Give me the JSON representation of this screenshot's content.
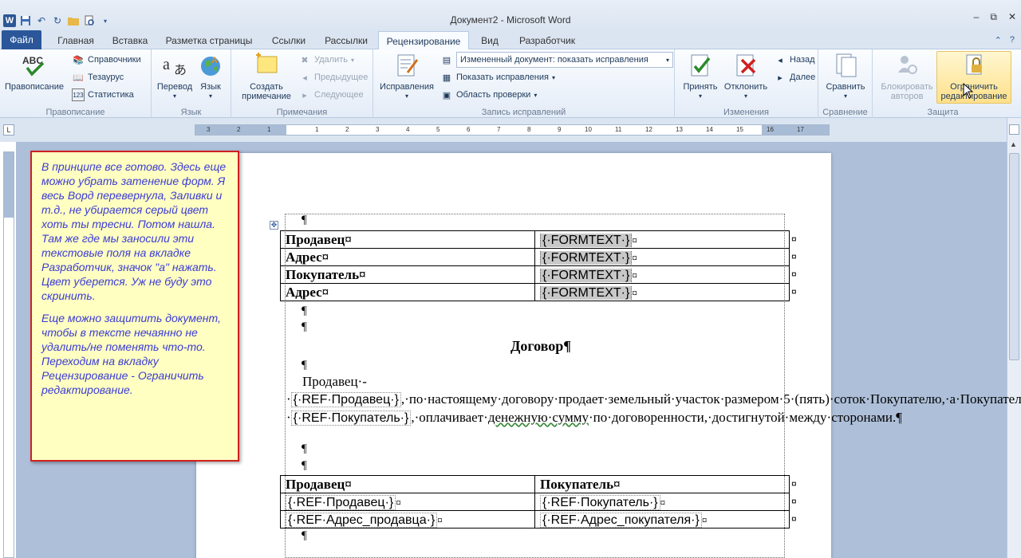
{
  "window": {
    "title": "Документ2 - Microsoft Word",
    "controls": [
      "–",
      "⧉",
      "✕"
    ]
  },
  "qat": {
    "logo": "W",
    "save_icon": "save-icon",
    "undo_icon": "undo-icon",
    "redo_icon": "redo-icon"
  },
  "tabs": [
    {
      "label": "Файл"
    },
    {
      "label": "Главная"
    },
    {
      "label": "Вставка"
    },
    {
      "label": "Разметка страницы"
    },
    {
      "label": "Ссылки"
    },
    {
      "label": "Рассылки"
    },
    {
      "label": "Рецензирование"
    },
    {
      "label": "Вид"
    },
    {
      "label": "Разработчик"
    }
  ],
  "active_tab": "Рецензирование",
  "ribbon": {
    "spelling": {
      "label": "Правописание",
      "btn_spelling": "Правописание",
      "btn_research": "Справочники",
      "btn_thesaurus": "Тезаурус",
      "btn_stats": "Статистика",
      "abc": "ABC"
    },
    "language": {
      "label": "Язык",
      "btn_translate": "Перевод",
      "btn_language": "Язык"
    },
    "comments": {
      "label": "Примечания",
      "btn_new_1": "Создать",
      "btn_new_2": "примечание",
      "btn_delete": "Удалить",
      "btn_prev": "Предыдущее",
      "btn_next": "Следующее"
    },
    "tracking": {
      "label": "Запись исправлений",
      "btn_track": "Исправления",
      "combo_display": "Измененный документ: показать исправления",
      "btn_show_markup": "Показать исправления",
      "btn_reviewing_pane": "Область проверки"
    },
    "changes": {
      "label": "Изменения",
      "btn_accept": "Принять",
      "btn_reject": "Отклонить",
      "btn_previous": "Назад",
      "btn_next": "Далее"
    },
    "compare": {
      "label": "Сравнение",
      "btn_compare": "Сравнить"
    },
    "protect": {
      "label": "Защита",
      "btn_block_1": "Блокировать",
      "btn_block_2": "авторов",
      "btn_restrict_1": "Ограничить",
      "btn_restrict_2": "редактирование"
    }
  },
  "ruler": {
    "corner": "L",
    "ticks": [
      "3",
      "2",
      "1",
      "1",
      "2",
      "3",
      "4",
      "5",
      "6",
      "7",
      "8",
      "9",
      "10",
      "11",
      "12",
      "13",
      "14",
      "15",
      "16",
      "17"
    ]
  },
  "callout": {
    "p1": "В принципе все готово. Здесь еще можно убрать затенение форм. Я весь Ворд перевернула, Заливки и т.д., не убирается серый цвет хоть ты тресни. Потом нашла. Там же где мы заносили эти текстовые поля на вкладке Разработчик, значок \"а\" нажать. Цвет уберется. Уж не буду это скринить.",
    "p2": "Еще можно защитить документ, чтобы в тексте нечаянно не удалить/не поменять что-то. Переходим на вкладку Рецензирование - Ограничить редактирование."
  },
  "document": {
    "pilcrow": "¶",
    "cell_mark": "¤",
    "end_mark": "¤",
    "table1": [
      {
        "label": "Продавец¤",
        "field": "{·FORMTEXT·}",
        "after": "¤"
      },
      {
        "label": "Адрес¤",
        "field": "{·FORMTEXT·}",
        "after": "¤"
      },
      {
        "label": "Покупатель¤",
        "field": "{·FORMTEXT·}",
        "after": "¤"
      },
      {
        "label": "Адрес¤",
        "field": "{·FORMTEXT·}",
        "after": "¤"
      }
    ],
    "title": "Договор¶",
    "para": {
      "s1": "Продавец·-·",
      "f1": "{·REF·Продавец·}",
      "s2": ",·по·настоящему·договору·продает·земельный·участок·размером·5·(пять)·соток·Покупателю,·а·Покупатель·-·",
      "f2": "{·REF·Покупатель·}",
      "s3": ",·оплачивает·",
      "s4": "денежную·сумму",
      "s5": "·по·договоренности,·достигнутой·между·сторонами.¶"
    },
    "table2_header": {
      "c1": "Продавец¤",
      "c2": "Покупатель¤"
    },
    "table2_rows": [
      {
        "c1": "{·REF·Продавец·}",
        "c1_after": "¤",
        "c2": "{·REF·Покупатель·}",
        "c2_after": "¤"
      },
      {
        "c1": "{·REF·Адрес_продавца·}",
        "c1_after": "¤",
        "c2": "{·REF·Адрес_покупателя·}",
        "c2_after": "¤"
      }
    ]
  }
}
